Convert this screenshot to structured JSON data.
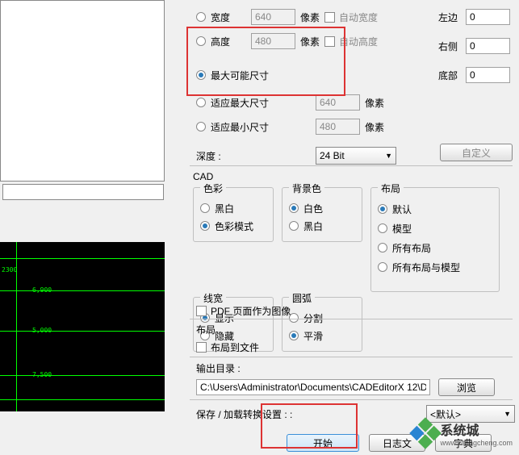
{
  "dims": {
    "width_label": "宽度",
    "width_value": "640",
    "width_unit": "像素",
    "auto_width": "自动宽度",
    "height_label": "高度",
    "height_value": "480",
    "height_unit": "像素",
    "auto_height": "自动高度",
    "max_possible": "最大可能尺寸",
    "fit_max": "适应最大尺寸",
    "fit_max_value": "640",
    "fit_max_unit": "像素",
    "fit_min": "适应最小尺寸",
    "fit_min_value": "480",
    "fit_min_unit": "像素",
    "depth_label": "深度 :",
    "depth_value": "24 Bit"
  },
  "margins": {
    "left_label": "左边",
    "left_value": "0",
    "right_label": "右侧",
    "right_value": "0",
    "bottom_label": "底部",
    "bottom_value": "0"
  },
  "custom_btn": "自定义",
  "cad": {
    "title": "CAD",
    "color": {
      "legend": "色彩",
      "bw": "黑白",
      "colormode": "色彩模式"
    },
    "bg": {
      "legend": "背景色",
      "white": "白色",
      "black": "黑白"
    },
    "layout": {
      "legend": "布局",
      "default": "默认",
      "model": "模型",
      "all": "所有布局",
      "all_model": "所有布局与模型"
    },
    "linew": {
      "legend": "线宽",
      "show": "显示",
      "hide": "隐藏"
    },
    "arc": {
      "legend": "圆弧",
      "split": "分割",
      "smooth": "平滑"
    }
  },
  "pdf_as_image": "PDF 页面作为图像",
  "layout_section": {
    "title": "布局",
    "layout_to_file": "布局到文件"
  },
  "output": {
    "label": "输出目录 :",
    "path": "C:\\Users\\Administrator\\Documents\\CADEditorX 12\\D",
    "browse": "浏览"
  },
  "save_load": {
    "label": "保存 / 加载转换设置 : :",
    "value": "<默认>"
  },
  "start_btn": "开始",
  "log_btn": "日志文",
  "dictdict_btn": "字典",
  "watermark": {
    "brand": "系统城",
    "url": "www.xitongcheng.com"
  },
  "preview": {
    "v1": "2300",
    "v2": "6,900",
    "v3": "5,000",
    "v4": "7,500"
  }
}
